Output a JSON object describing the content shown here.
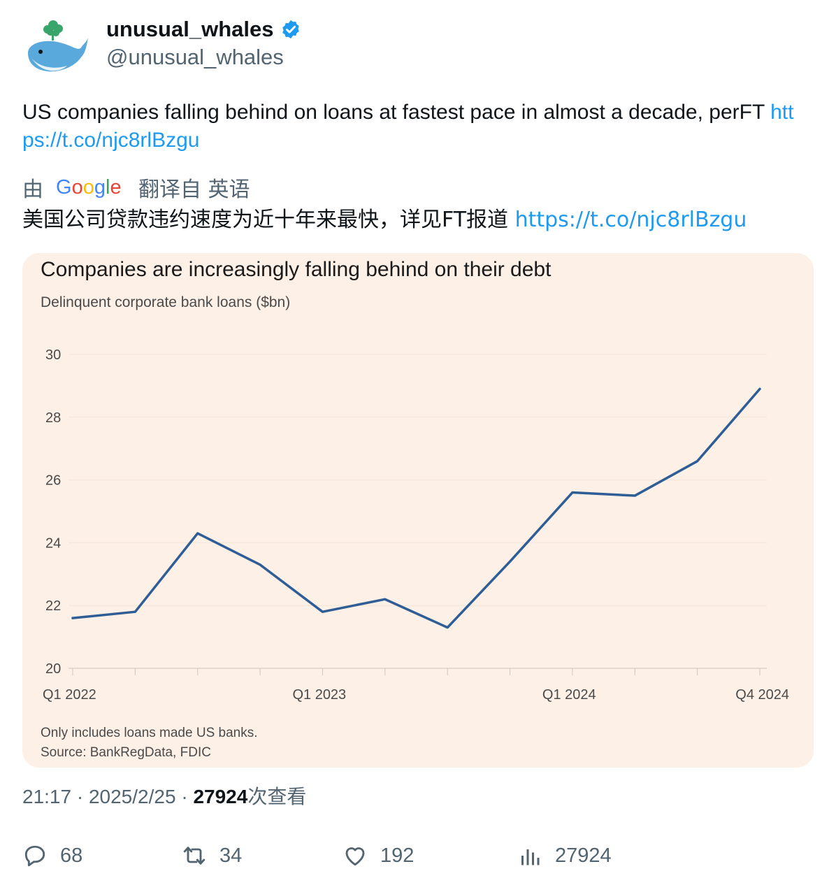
{
  "author": {
    "name": "unusual_whales",
    "handle": "@unusual_whales"
  },
  "tweet": {
    "text": "US companies falling behind on loans at fastest pace in almost a decade, perFT ",
    "link": "https://t.co/njc8rlBzgu"
  },
  "translation": {
    "prefix": "由",
    "provider": "Google",
    "suffix": "翻译自 英语",
    "text": "美国公司贷款违约速度为近十年来最快，详见FT报道 ",
    "link": "https://t.co/njc8rlBzgu"
  },
  "chart_data": {
    "type": "line",
    "title": "Companies are increasingly falling behind on their debt",
    "subtitle": "Delinquent corporate bank loans ($bn)",
    "x": [
      "Q1 2022",
      "Q2 2022",
      "Q3 2022",
      "Q4 2022",
      "Q1 2023",
      "Q2 2023",
      "Q3 2023",
      "Q4 2023",
      "Q1 2024",
      "Q2 2024",
      "Q3 2024",
      "Q4 2024"
    ],
    "x_tick_labels": [
      "Q1 2022",
      "Q1 2023",
      "Q1 2024",
      "Q4 2024"
    ],
    "x_tick_label_indices": [
      0,
      4,
      8,
      11
    ],
    "series": [
      {
        "values": [
          21.6,
          21.8,
          24.3,
          23.3,
          21.8,
          22.2,
          21.3,
          23.4,
          25.6,
          25.5,
          26.6,
          28.9
        ],
        "color": "#2f5d95"
      }
    ],
    "ylim": [
      20,
      30
    ],
    "yticks": [
      20,
      22,
      24,
      26,
      28,
      30
    ],
    "grid": true,
    "notes": [
      "Only includes loans made US banks.",
      "Source: BankRegData, FDIC"
    ]
  },
  "meta": {
    "time": "21:17",
    "date": "2025/2/25",
    "views": "27924",
    "views_label": "次查看"
  },
  "actions": {
    "replies": "68",
    "retweets": "34",
    "likes": "192",
    "views": "27924"
  },
  "colors": {
    "link": "#1d9bf0",
    "card_bg": "#fdf0e6",
    "line": "#2f5d95",
    "muted": "#536471"
  }
}
